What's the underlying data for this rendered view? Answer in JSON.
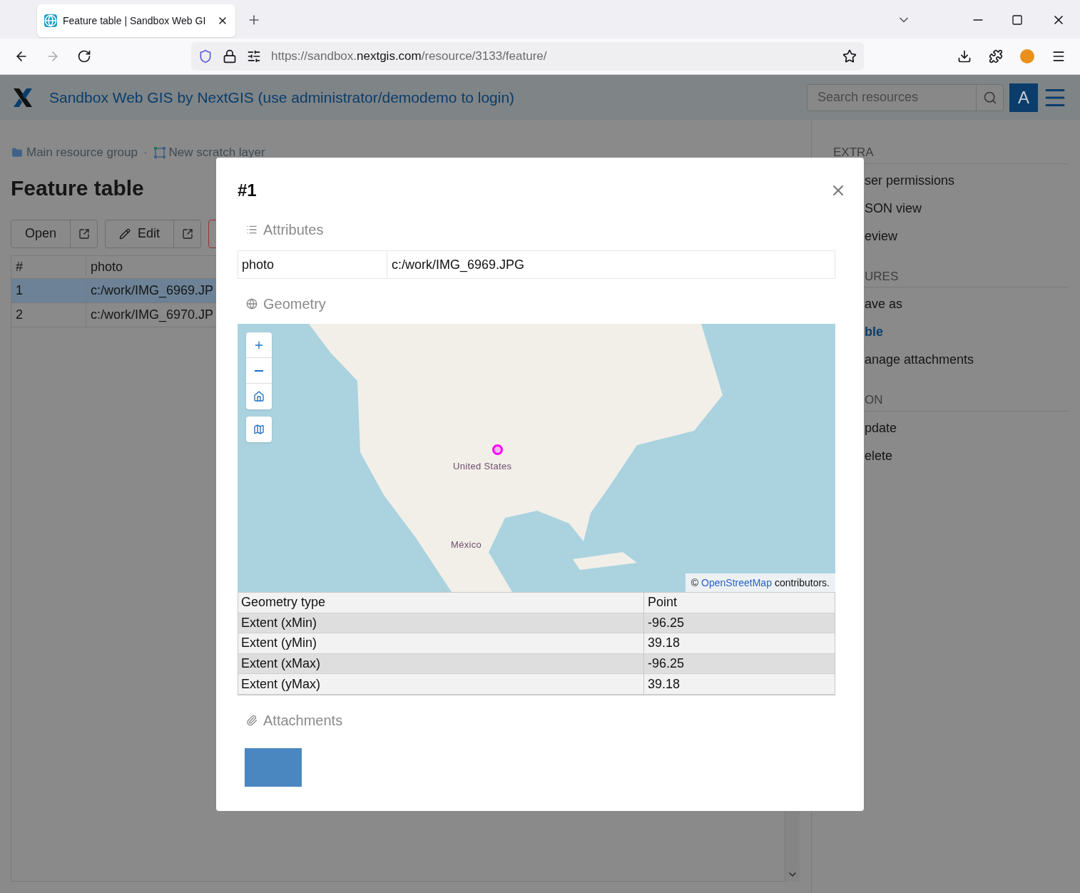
{
  "browser": {
    "tab": {
      "title": "Feature table | Sandbox Web GI"
    },
    "url": {
      "prefix": "https://sandbox.",
      "domain": "nextgis.com",
      "suffix": "/resource/3133/feature/"
    }
  },
  "header": {
    "title": "Sandbox Web GIS by NextGIS (use administrator/demodemo to login)",
    "search": {
      "placeholder": "Search resources"
    },
    "avatar": "A"
  },
  "breadcrumb_separator": "·",
  "breadcrumbs": [
    {
      "kind": "group",
      "label": "Main resource group"
    },
    {
      "kind": "layer",
      "label": "New scratch layer"
    }
  ],
  "page_title": "Feature table",
  "toolbar": [
    {
      "kind": "open",
      "label": "Open"
    },
    {
      "kind": "edit",
      "label": "Edit"
    }
  ],
  "table": {
    "columns": [
      "#",
      "photo"
    ],
    "rows": [
      {
        "cells": [
          "1",
          "c:/work/IMG_6969.JP"
        ],
        "selected": true
      },
      {
        "cells": [
          "2",
          "c:/work/IMG_6970.JP"
        ],
        "selected": false
      }
    ]
  },
  "sidebar": {
    "sections": [
      {
        "title": "EXTRA",
        "cut": false,
        "items": [
          {
            "label": "ser permissions",
            "selected": false
          },
          {
            "label": "SON view",
            "selected": false
          },
          {
            "label": "eview",
            "selected": false
          }
        ]
      },
      {
        "title": "URES",
        "cut": true,
        "items": [
          {
            "label": "ave as",
            "selected": false
          },
          {
            "label": "ble",
            "selected": true
          },
          {
            "label": "anage attachments",
            "selected": false
          }
        ]
      },
      {
        "title": "ON",
        "cut": true,
        "items": [
          {
            "label": "pdate",
            "selected": false
          },
          {
            "label": "elete",
            "selected": false
          }
        ]
      }
    ]
  },
  "modal": {
    "title": "#1",
    "attributes": {
      "heading": "Attributes",
      "rows": [
        {
          "name": "photo",
          "value": "c:/work/IMG_6969.JPG"
        }
      ]
    },
    "geometry": {
      "heading": "Geometry",
      "map": {
        "labels": [
          "United States",
          "México"
        ],
        "attribution": {
          "prefix": "©",
          "link": "OpenStreetMap",
          "suffix": "contributors."
        }
      },
      "rows": [
        {
          "name": "Geometry type",
          "value": "Point"
        },
        {
          "name": "Extent (xMin)",
          "value": "-96.25"
        },
        {
          "name": "Extent (yMin)",
          "value": "39.18"
        },
        {
          "name": "Extent (xMax)",
          "value": "-96.25"
        },
        {
          "name": "Extent (yMax)",
          "value": "39.18"
        }
      ]
    },
    "attachments": {
      "heading": "Attachments"
    }
  }
}
